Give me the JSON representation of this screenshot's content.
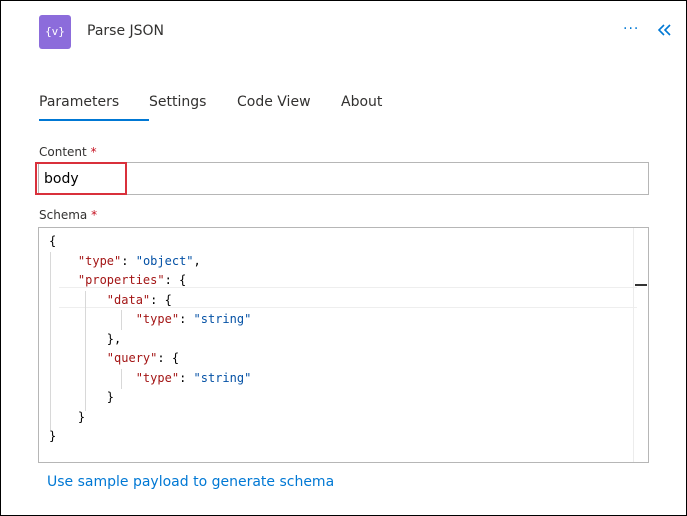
{
  "header": {
    "icon_text": "{v}",
    "title": "Parse JSON",
    "more_label": "···"
  },
  "tabs": [
    {
      "label": "Parameters",
      "active": true
    },
    {
      "label": "Settings",
      "active": false
    },
    {
      "label": "Code View",
      "active": false
    },
    {
      "label": "About",
      "active": false
    }
  ],
  "content_field": {
    "label": "Content",
    "required_marker": "*",
    "value": "body"
  },
  "schema_field": {
    "label": "Schema",
    "required_marker": "*"
  },
  "schema_lines": [
    "{",
    "    \"type\": \"object\",",
    "    \"properties\": {",
    "        \"data\": {",
    "            \"type\": \"string\"",
    "        },",
    "        \"query\": {",
    "            \"type\": \"string\"",
    "        }",
    "    }",
    "}"
  ],
  "sample_link": "Use sample payload to generate schema",
  "colors": {
    "accent": "#0078d4",
    "icon_bg": "#8c6cdb",
    "highlight": "#d9303b",
    "required": "#c50f1f",
    "json_key": "#a31515",
    "json_string": "#0451a5"
  }
}
